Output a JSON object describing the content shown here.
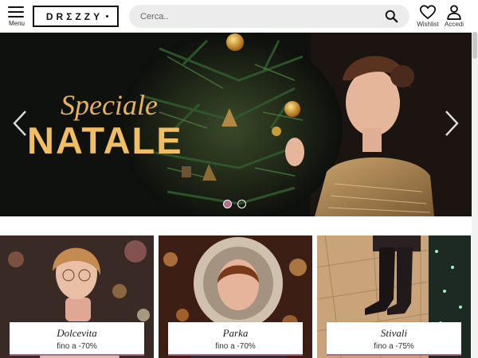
{
  "header": {
    "menu_label": "Menu",
    "logo_text": "DRΣZZY",
    "search_placeholder": "Cerca..",
    "wishlist_label": "Wishlist",
    "login_label": "Accedi"
  },
  "hero": {
    "title_line1": "Speciale",
    "title_line2": "NATALE",
    "slide_count": 2,
    "active_slide": 1
  },
  "categories": [
    {
      "name": "Dolcevita",
      "discount": "fino a -70%"
    },
    {
      "name": "Parka",
      "discount": "fino a -70%"
    },
    {
      "name": "Stivali",
      "discount": "fino a -75%"
    }
  ],
  "colors": {
    "accent": "#b46c8a",
    "hero_gold": "#f1be63",
    "search_bg": "#ececec"
  },
  "icons": [
    "hamburger-icon",
    "search-icon",
    "heart-icon",
    "user-icon",
    "chevron-left-icon",
    "chevron-right-icon"
  ]
}
